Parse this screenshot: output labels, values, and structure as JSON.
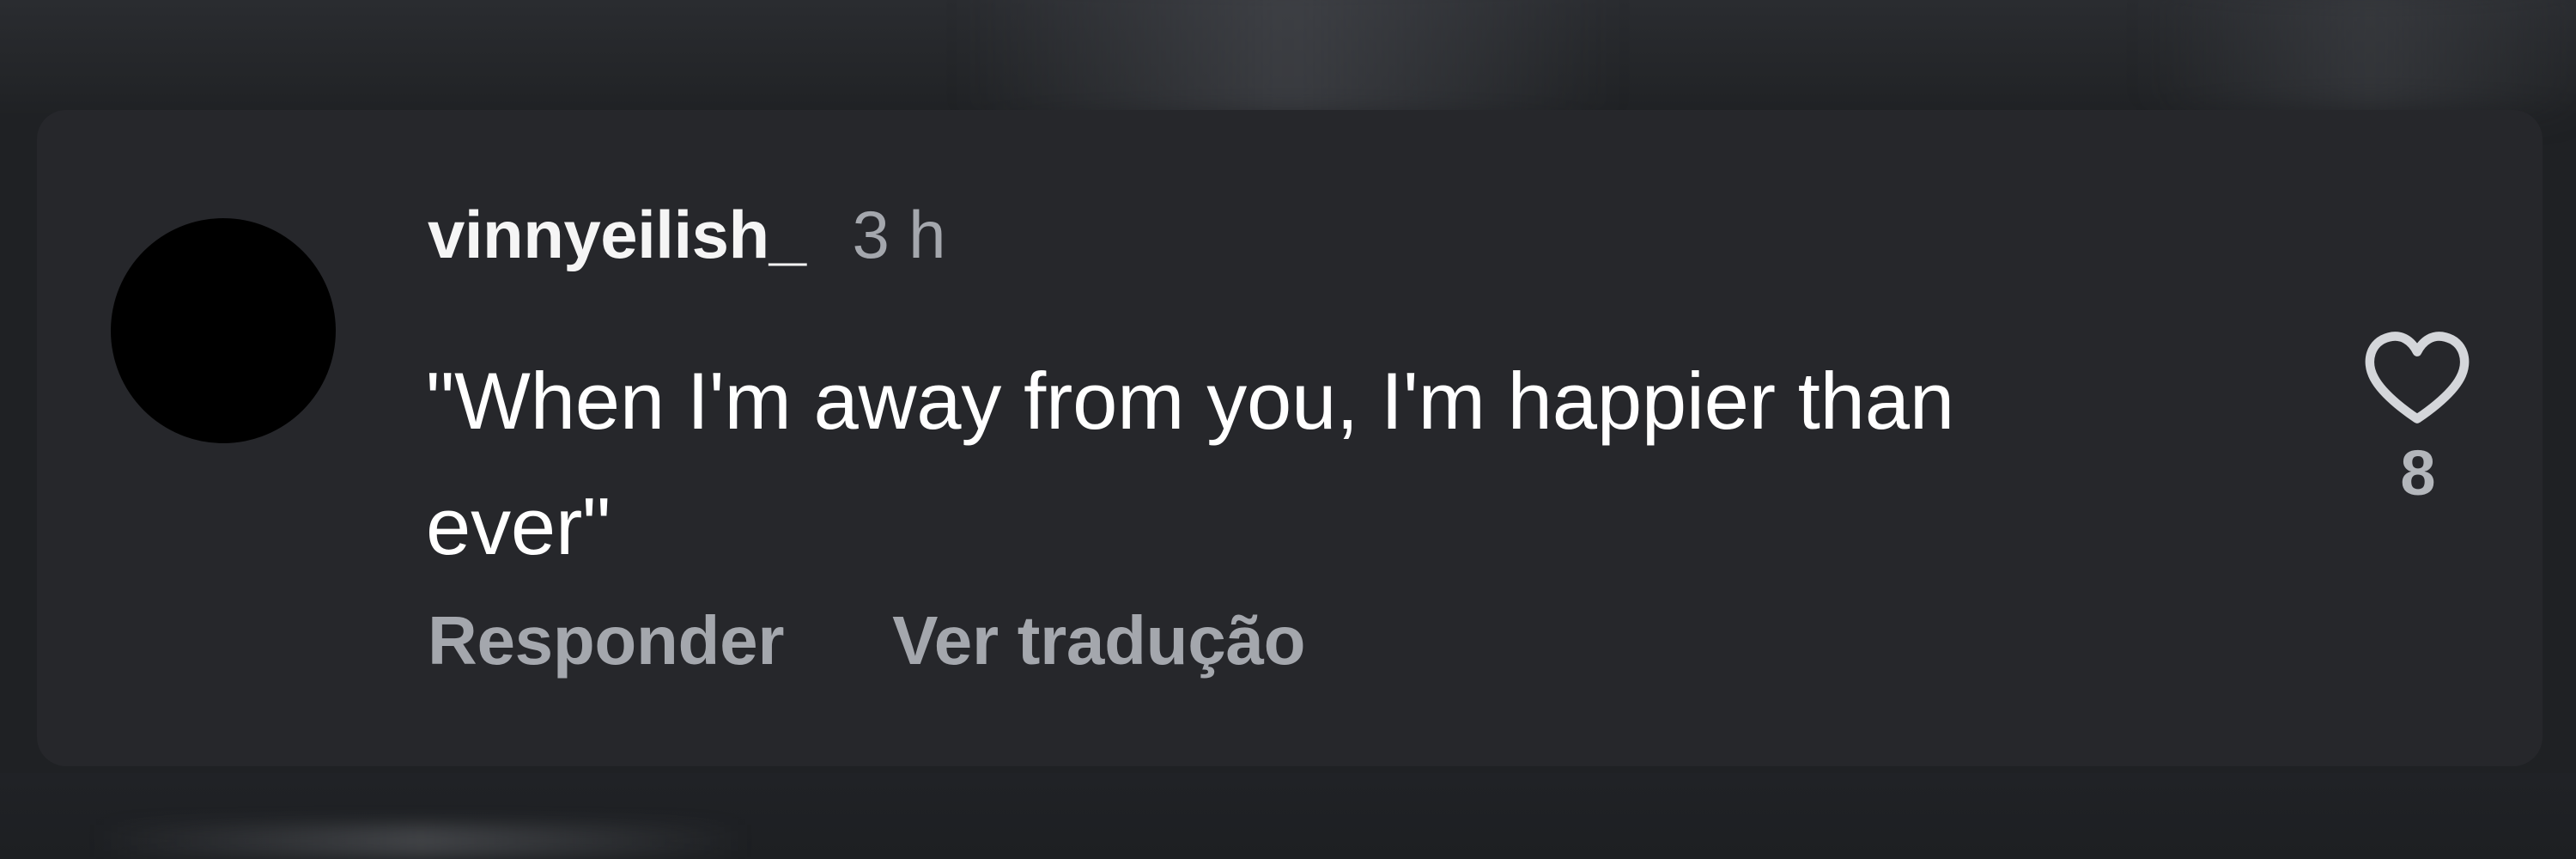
{
  "comment": {
    "username": "vinnyeilish_",
    "time_ago": "3 h",
    "text_lines": [
      "\"When I'm away from you, I'm happier than",
      "ever\""
    ],
    "actions": {
      "reply_label": "Responder",
      "translate_label": "Ver tradução"
    },
    "likes": {
      "icon": "heart-icon",
      "count": "8"
    }
  },
  "colors": {
    "page_background": "#1f2124",
    "card_background": "#26272b",
    "primary_text": "#ffffff",
    "secondary_text": "#a4a7ad",
    "avatar": "#000000"
  }
}
